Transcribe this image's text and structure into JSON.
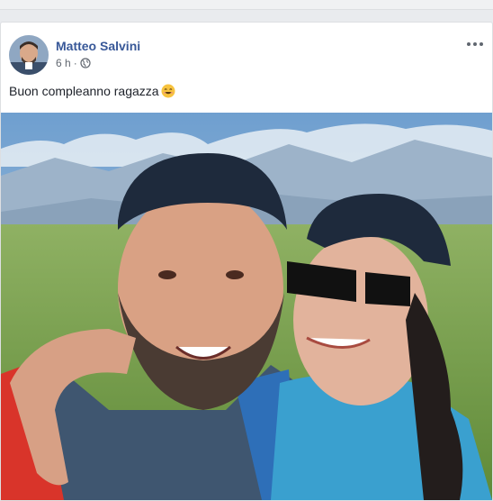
{
  "post": {
    "author": "Matteo Salvini",
    "time": "6 h",
    "separator": "·",
    "privacy_icon": "globe-icon",
    "text": "Buon compleanno ragazza",
    "emoji": "smiling-face-emoji",
    "more_icon": "more-options-icon"
  },
  "colors": {
    "author_link": "#385898",
    "meta": "#616770",
    "background": "#e9ebee"
  }
}
